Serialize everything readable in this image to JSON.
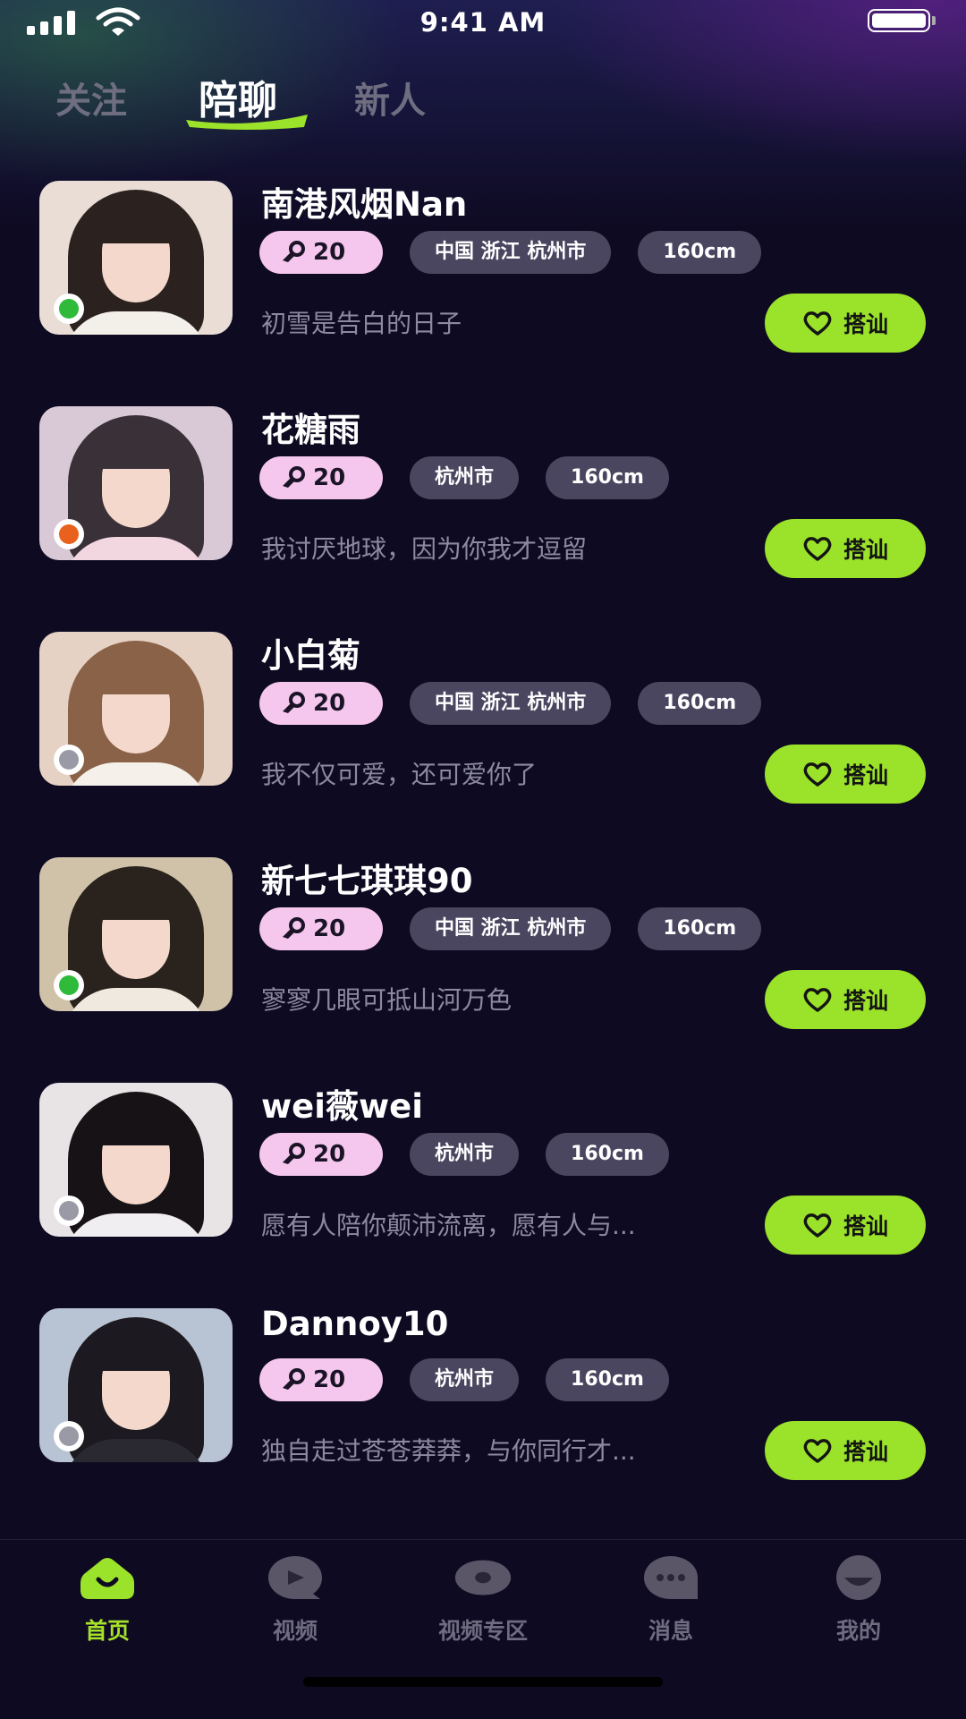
{
  "status_bar": {
    "time": "9:41 AM"
  },
  "tabs": [
    {
      "label": "关注",
      "active": false
    },
    {
      "label": "陪聊",
      "active": true
    },
    {
      "label": "新人",
      "active": false
    }
  ],
  "colors": {
    "accent": "#9be22a",
    "tag_bg": "#4b4660",
    "level_bg": "#f5c6ee",
    "online": "#2fba3a",
    "busy": "#e8621e",
    "offline": "#9a9aa6"
  },
  "users": [
    {
      "name": "南港风烟Nan",
      "level": "20",
      "tags": [
        "中国 浙江 杭州市",
        "160cm"
      ],
      "bio": "初雪是告白的日子",
      "status": "online",
      "button": "搭讪"
    },
    {
      "name": "花糖雨",
      "level": "20",
      "tags": [
        "杭州市",
        "160cm"
      ],
      "bio": "我讨厌地球，因为你我才逗留",
      "status": "busy",
      "button": "搭讪"
    },
    {
      "name": "小白菊",
      "level": "20",
      "tags": [
        "中国 浙江 杭州市",
        "160cm"
      ],
      "bio": "我不仅可爱，还可爱你了",
      "status": "offline",
      "button": "搭讪"
    },
    {
      "name": "新七七琪琪90",
      "level": "20",
      "tags": [
        "中国 浙江 杭州市",
        "160cm"
      ],
      "bio": "寥寥几眼可抵山河万色",
      "status": "online",
      "button": "搭讪"
    },
    {
      "name": "wei薇wei",
      "level": "20",
      "tags": [
        "杭州市",
        "160cm"
      ],
      "bio": "愿有人陪你颠沛流离，愿有人与...",
      "status": "offline",
      "button": "搭讪"
    },
    {
      "name": "Dannoy10",
      "level": "20",
      "tags": [
        "杭州市",
        "160cm"
      ],
      "bio": "独自走过苍苍莽莽，与你同行才...",
      "status": "offline",
      "button": "搭讪"
    }
  ],
  "bottom_nav": [
    {
      "label": "首页",
      "icon": "home-icon",
      "active": true
    },
    {
      "label": "视频",
      "icon": "video-icon",
      "active": false
    },
    {
      "label": "视频专区",
      "icon": "video-zone-icon",
      "active": false
    },
    {
      "label": "消息",
      "icon": "message-icon",
      "active": false
    },
    {
      "label": "我的",
      "icon": "profile-icon",
      "active": false
    }
  ]
}
